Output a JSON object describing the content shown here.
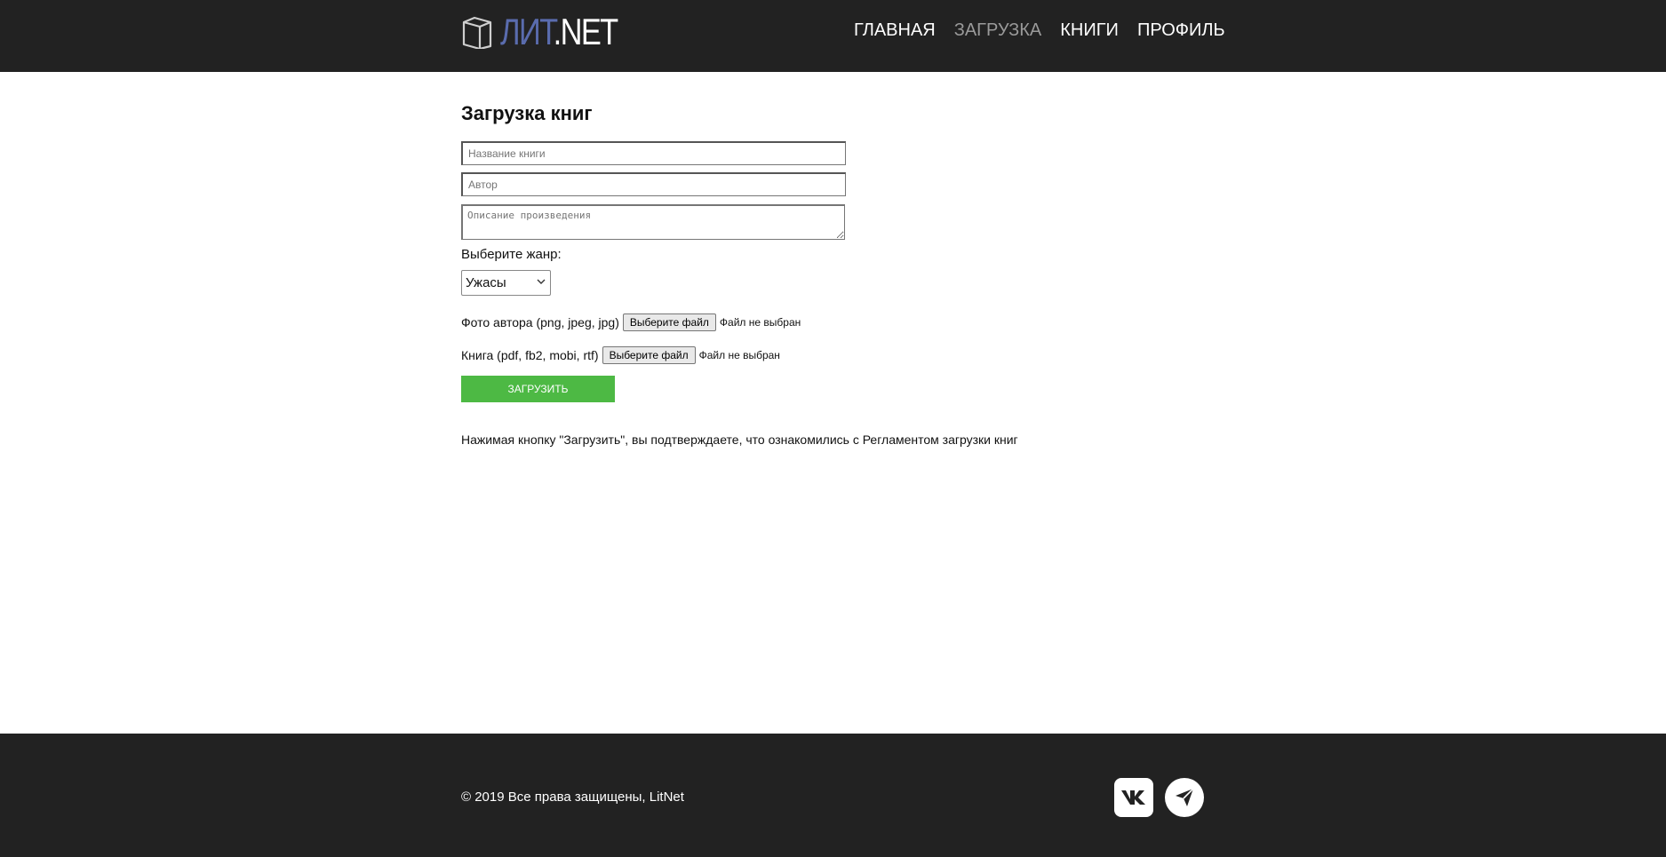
{
  "header": {
    "logo_icon": "open-book-icon",
    "logo_lit": "ЛИТ",
    "logo_net": ".NET",
    "nav": [
      {
        "label": "ГЛАВНАЯ",
        "active": false
      },
      {
        "label": "ЗАГРУЗКА",
        "active": true
      },
      {
        "label": "КНИГИ",
        "active": false
      },
      {
        "label": "ПРОФИЛЬ",
        "active": false
      }
    ]
  },
  "form": {
    "title": "Загрузка книг",
    "book_title_placeholder": "Название книги",
    "author_placeholder": "Автор",
    "description_placeholder": "Описание произведения",
    "genre_label": "Выберите жанр:",
    "genre_selected": "Ужасы",
    "author_photo_label": "Фото автора (png, jpeg, jpg)",
    "book_file_label": "Книга (pdf, fb2, mobi, rtf)",
    "file_button_label": "Выберите файл",
    "file_status": "Файл не выбран",
    "upload_button": "Загрузить",
    "notice": "Нажимая кнопку \"Загрузить\", вы подтверждаете, что ознакомились с Регламентом загрузки книг"
  },
  "footer": {
    "copyright": "© 2019 Все права защищены, LitNet",
    "social": [
      "vk-icon",
      "telegram-icon"
    ]
  },
  "colors": {
    "header_bg": "#222222",
    "logo_accent": "#5a6cae",
    "nav_active": "#9a9a9a",
    "upload_button": "#4db944"
  }
}
